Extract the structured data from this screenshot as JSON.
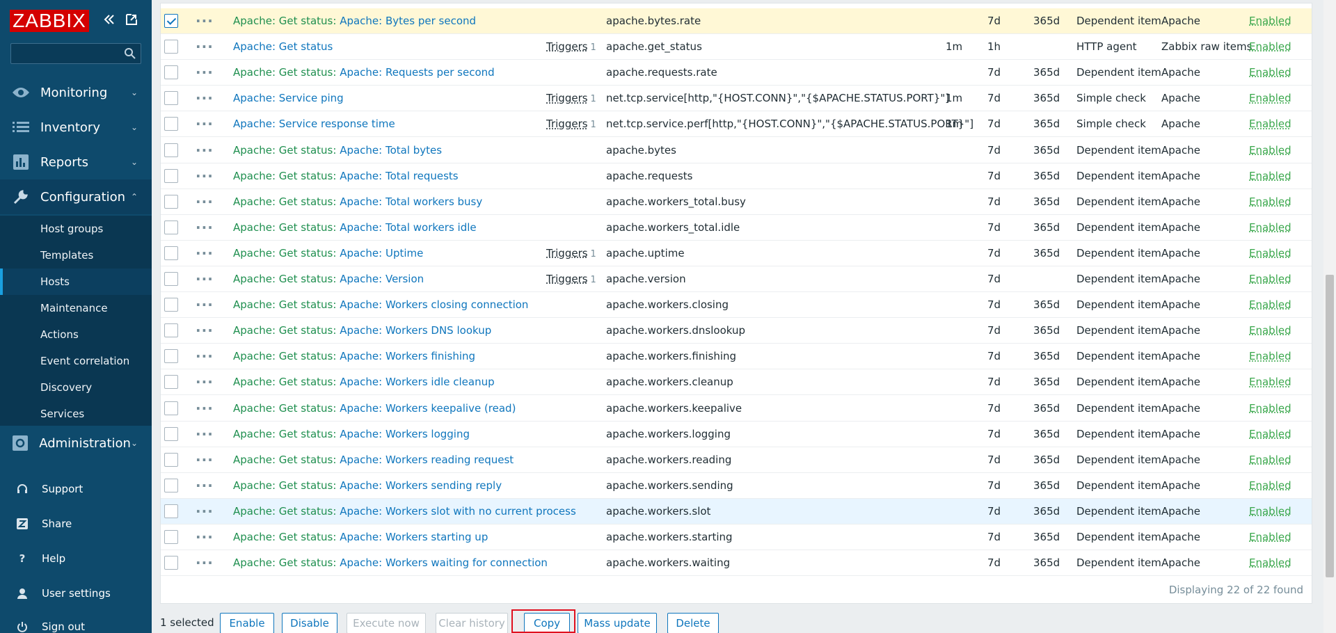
{
  "brand": {
    "logo": "ZABBIX",
    "logo_color": "#d40000",
    "sidebar_color": "#0e4a6c"
  },
  "sidebar": {
    "menu": [
      {
        "label": "Monitoring",
        "icon": "eye-icon"
      },
      {
        "label": "Inventory",
        "icon": "list-icon"
      },
      {
        "label": "Reports",
        "icon": "bar-chart-icon"
      },
      {
        "label": "Configuration",
        "icon": "wrench-icon"
      },
      {
        "label": "Administration",
        "icon": "gear-icon"
      }
    ],
    "config_items": [
      "Host groups",
      "Templates",
      "Hosts",
      "Maintenance",
      "Actions",
      "Event correlation",
      "Discovery",
      "Services"
    ],
    "selected_config_item": "Hosts",
    "bottom": [
      {
        "label": "Support",
        "icon": "headset-icon"
      },
      {
        "label": "Share",
        "icon": "share-z-icon"
      },
      {
        "label": "Help",
        "icon": "help-icon"
      },
      {
        "label": "User settings",
        "icon": "user-icon"
      },
      {
        "label": "Sign out",
        "icon": "power-icon"
      }
    ]
  },
  "table": {
    "trigger_label": "Triggers",
    "rows": [
      {
        "prefix": "Apache: Get status: ",
        "name": "Apache: Bytes per second",
        "triggers": "",
        "key": "apache.bytes.rate",
        "interval": "",
        "history": "7d",
        "trends": "365d",
        "type": "Dependent item",
        "app": "Apache",
        "status": "Enabled",
        "checked": true
      },
      {
        "prefix": "",
        "name": "Apache: Get status",
        "triggers": "1",
        "key": "apache.get_status",
        "interval": "1m",
        "history": "1h",
        "trends": "",
        "type": "HTTP agent",
        "app": "Zabbix raw items",
        "status": "Enabled"
      },
      {
        "prefix": "Apache: Get status: ",
        "name": "Apache: Requests per second",
        "triggers": "",
        "key": "apache.requests.rate",
        "interval": "",
        "history": "7d",
        "trends": "365d",
        "type": "Dependent item",
        "app": "Apache",
        "status": "Enabled"
      },
      {
        "prefix": "",
        "name": "Apache: Service ping",
        "triggers": "1",
        "key": "net.tcp.service[http,\"{HOST.CONN}\",\"{$APACHE.STATUS.PORT}\"]",
        "interval": "1m",
        "history": "7d",
        "trends": "365d",
        "type": "Simple check",
        "app": "Apache",
        "status": "Enabled"
      },
      {
        "prefix": "",
        "name": "Apache: Service response time",
        "triggers": "1",
        "key": "net.tcp.service.perf[http,\"{HOST.CONN}\",\"{$APACHE.STATUS.PORT}\"]",
        "interval": "1m",
        "history": "7d",
        "trends": "365d",
        "type": "Simple check",
        "app": "Apache",
        "status": "Enabled"
      },
      {
        "prefix": "Apache: Get status: ",
        "name": "Apache: Total bytes",
        "triggers": "",
        "key": "apache.bytes",
        "interval": "",
        "history": "7d",
        "trends": "365d",
        "type": "Dependent item",
        "app": "Apache",
        "status": "Enabled"
      },
      {
        "prefix": "Apache: Get status: ",
        "name": "Apache: Total requests",
        "triggers": "",
        "key": "apache.requests",
        "interval": "",
        "history": "7d",
        "trends": "365d",
        "type": "Dependent item",
        "app": "Apache",
        "status": "Enabled"
      },
      {
        "prefix": "Apache: Get status: ",
        "name": "Apache: Total workers busy",
        "triggers": "",
        "key": "apache.workers_total.busy",
        "interval": "",
        "history": "7d",
        "trends": "365d",
        "type": "Dependent item",
        "app": "Apache",
        "status": "Enabled"
      },
      {
        "prefix": "Apache: Get status: ",
        "name": "Apache: Total workers idle",
        "triggers": "",
        "key": "apache.workers_total.idle",
        "interval": "",
        "history": "7d",
        "trends": "365d",
        "type": "Dependent item",
        "app": "Apache",
        "status": "Enabled"
      },
      {
        "prefix": "Apache: Get status: ",
        "name": "Apache: Uptime",
        "triggers": "1",
        "key": "apache.uptime",
        "interval": "",
        "history": "7d",
        "trends": "365d",
        "type": "Dependent item",
        "app": "Apache",
        "status": "Enabled"
      },
      {
        "prefix": "Apache: Get status: ",
        "name": "Apache: Version",
        "triggers": "1",
        "key": "apache.version",
        "interval": "",
        "history": "7d",
        "trends": "",
        "type": "Dependent item",
        "app": "Apache",
        "status": "Enabled"
      },
      {
        "prefix": "Apache: Get status: ",
        "name": "Apache: Workers closing connection",
        "triggers": "",
        "key": "apache.workers.closing",
        "interval": "",
        "history": "7d",
        "trends": "365d",
        "type": "Dependent item",
        "app": "Apache",
        "status": "Enabled"
      },
      {
        "prefix": "Apache: Get status: ",
        "name": "Apache: Workers DNS lookup",
        "triggers": "",
        "key": "apache.workers.dnslookup",
        "interval": "",
        "history": "7d",
        "trends": "365d",
        "type": "Dependent item",
        "app": "Apache",
        "status": "Enabled"
      },
      {
        "prefix": "Apache: Get status: ",
        "name": "Apache: Workers finishing",
        "triggers": "",
        "key": "apache.workers.finishing",
        "interval": "",
        "history": "7d",
        "trends": "365d",
        "type": "Dependent item",
        "app": "Apache",
        "status": "Enabled"
      },
      {
        "prefix": "Apache: Get status: ",
        "name": "Apache: Workers idle cleanup",
        "triggers": "",
        "key": "apache.workers.cleanup",
        "interval": "",
        "history": "7d",
        "trends": "365d",
        "type": "Dependent item",
        "app": "Apache",
        "status": "Enabled"
      },
      {
        "prefix": "Apache: Get status: ",
        "name": "Apache: Workers keepalive (read)",
        "triggers": "",
        "key": "apache.workers.keepalive",
        "interval": "",
        "history": "7d",
        "trends": "365d",
        "type": "Dependent item",
        "app": "Apache",
        "status": "Enabled"
      },
      {
        "prefix": "Apache: Get status: ",
        "name": "Apache: Workers logging",
        "triggers": "",
        "key": "apache.workers.logging",
        "interval": "",
        "history": "7d",
        "trends": "365d",
        "type": "Dependent item",
        "app": "Apache",
        "status": "Enabled"
      },
      {
        "prefix": "Apache: Get status: ",
        "name": "Apache: Workers reading request",
        "triggers": "",
        "key": "apache.workers.reading",
        "interval": "",
        "history": "7d",
        "trends": "365d",
        "type": "Dependent item",
        "app": "Apache",
        "status": "Enabled"
      },
      {
        "prefix": "Apache: Get status: ",
        "name": "Apache: Workers sending reply",
        "triggers": "",
        "key": "apache.workers.sending",
        "interval": "",
        "history": "7d",
        "trends": "365d",
        "type": "Dependent item",
        "app": "Apache",
        "status": "Enabled"
      },
      {
        "prefix": "Apache: Get status: ",
        "name": "Apache: Workers slot with no current process",
        "triggers": "",
        "key": "apache.workers.slot",
        "interval": "",
        "history": "7d",
        "trends": "365d",
        "type": "Dependent item",
        "app": "Apache",
        "status": "Enabled",
        "hover": true
      },
      {
        "prefix": "Apache: Get status: ",
        "name": "Apache: Workers starting up",
        "triggers": "",
        "key": "apache.workers.starting",
        "interval": "",
        "history": "7d",
        "trends": "365d",
        "type": "Dependent item",
        "app": "Apache",
        "status": "Enabled"
      },
      {
        "prefix": "Apache: Get status: ",
        "name": "Apache: Workers waiting for connection",
        "triggers": "",
        "key": "apache.workers.waiting",
        "interval": "",
        "history": "7d",
        "trends": "365d",
        "type": "Dependent item",
        "app": "Apache",
        "status": "Enabled"
      }
    ],
    "footer": "Displaying 22 of 22 found"
  },
  "actions": {
    "selected_count": "1 selected",
    "buttons": [
      {
        "label": "Enable",
        "disabled": false
      },
      {
        "label": "Disable",
        "disabled": false
      },
      {
        "label": "Execute now",
        "disabled": true
      },
      {
        "label": "Clear history",
        "disabled": true
      },
      {
        "label": "Copy",
        "disabled": false,
        "highlighted": true
      },
      {
        "label": "Mass update",
        "disabled": false
      },
      {
        "label": "Delete",
        "disabled": false
      }
    ]
  }
}
